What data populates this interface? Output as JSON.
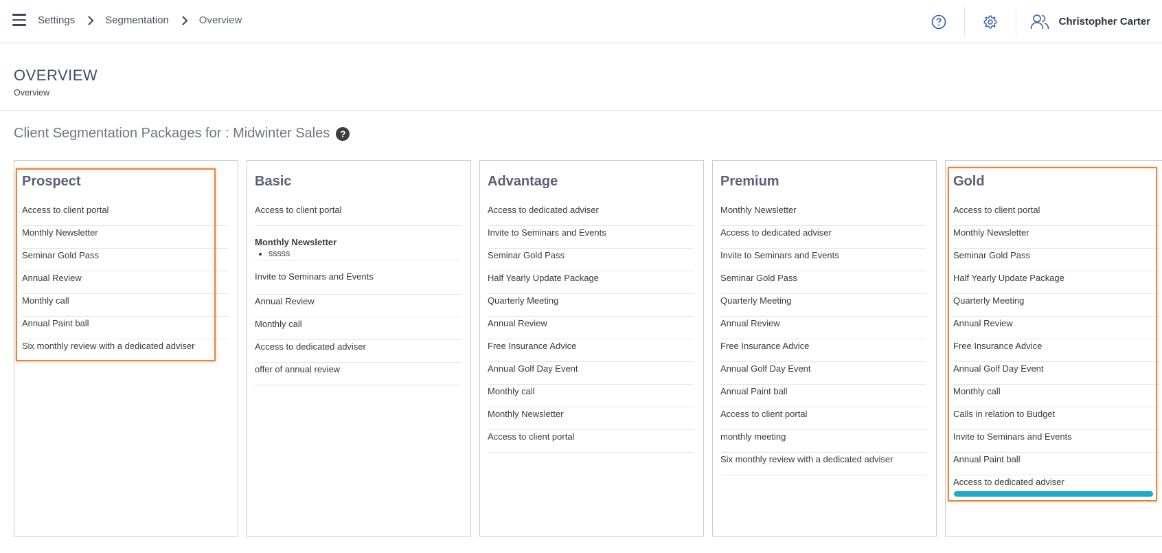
{
  "breadcrumb": [
    "Settings",
    "Segmentation",
    "Overview"
  ],
  "user": {
    "name": "Christopher Carter"
  },
  "icons": {
    "menu": "menu-icon",
    "help": "help-circle-icon",
    "settings": "gear-icon",
    "user": "users-icon"
  },
  "page": {
    "title": "OVERVIEW",
    "subtitle": "Overview"
  },
  "section_title": "Client Segmentation Packages for : Midwinter Sales",
  "help_badge": "?",
  "colors": {
    "accent": "#3d4b6e",
    "highlight": "#e9823a",
    "scrollbar": "#1eaac6"
  },
  "packages": [
    {
      "name": "Prospect",
      "items": [
        "Access to client portal",
        "Monthly Newsletter",
        "Seminar Gold Pass",
        "Annual Review",
        "Monthly call",
        "Annual Paint ball",
        "Six monthly review with a dedicated adviser"
      ]
    },
    {
      "name": "Basic",
      "items": [
        "Access to client portal",
        "Monthly Newsletter",
        "Invite to Seminars and Events",
        "Annual Review",
        "Monthly call",
        "Access to dedicated adviser",
        "offer of annual review"
      ],
      "sub_items": [
        "sssss"
      ]
    },
    {
      "name": "Advantage",
      "items": [
        "Access to dedicated adviser",
        "Invite to Seminars and Events",
        "Seminar Gold Pass",
        "Half Yearly Update Package",
        "Quarterly Meeting",
        "Annual Review",
        "Free Insurance Advice",
        "Annual Golf Day Event",
        "Monthly call",
        "Monthly Newsletter",
        "Access to client portal"
      ]
    },
    {
      "name": "Premium",
      "items": [
        "Monthly Newsletter",
        "Access to dedicated adviser",
        "Invite to Seminars and Events",
        "Seminar Gold Pass",
        "Quarterly Meeting",
        "Annual Review",
        "Free Insurance Advice",
        "Annual Golf Day Event",
        "Annual Paint ball",
        "Access to client portal",
        "monthly meeting",
        "Six monthly review with a dedicated adviser"
      ]
    },
    {
      "name": "Gold",
      "items": [
        "Access to client portal",
        "Monthly Newsletter",
        "Seminar Gold Pass",
        "Half Yearly Update Package",
        "Quarterly Meeting",
        "Annual Review",
        "Free Insurance Advice",
        "Annual Golf Day Event",
        "Monthly call",
        "Calls in relation to Budget",
        "Invite to Seminars and Events",
        "Annual Paint ball",
        "Access to dedicated adviser"
      ]
    }
  ]
}
